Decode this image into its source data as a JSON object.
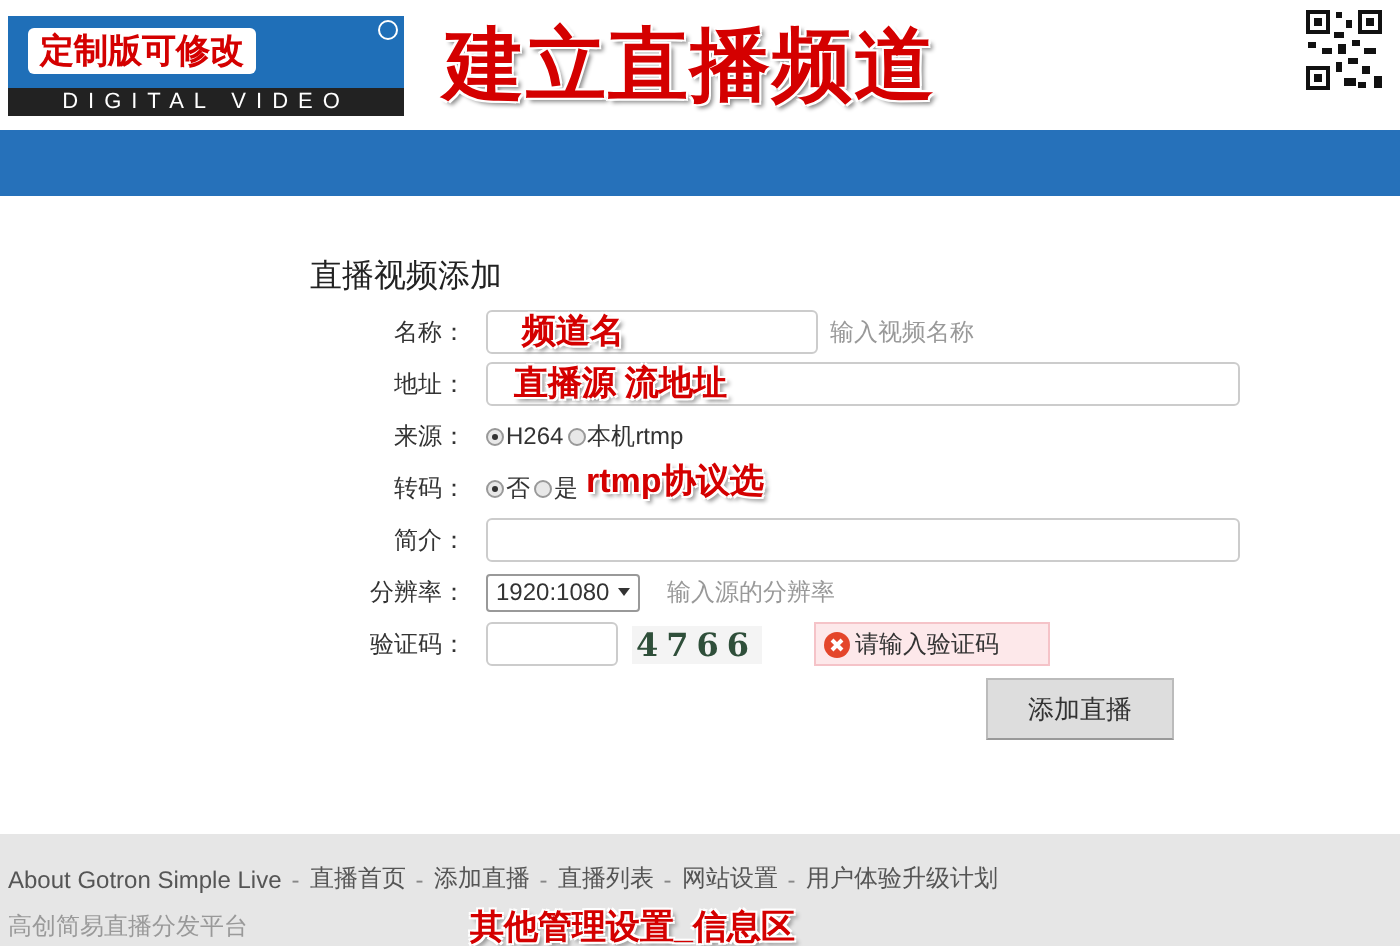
{
  "header": {
    "logo": {
      "overlay_text": "定制版可修改",
      "tagline": "DIGITAL VIDEO"
    },
    "title": "建立直播频道"
  },
  "form": {
    "title": "直播视频添加",
    "rows": [
      {
        "kind": "text",
        "label": "名称：",
        "value": "",
        "hint": "输入视频名称",
        "annotation": "频道名"
      },
      {
        "kind": "text",
        "label": "地址：",
        "value": "",
        "annotation": "直播源 流地址"
      },
      {
        "kind": "radio",
        "label": "来源：",
        "options": [
          {
            "label": "H264",
            "selected": true
          },
          {
            "label": "本机rtmp",
            "selected": false
          }
        ]
      },
      {
        "kind": "radio",
        "label": "转码：",
        "options": [
          {
            "label": "否",
            "selected": true
          },
          {
            "label": "是",
            "selected": false
          }
        ],
        "annotation": "rtmp协议选"
      },
      {
        "kind": "text",
        "label": "简介：",
        "value": ""
      },
      {
        "kind": "select",
        "label": "分辨率：",
        "value": "1920:1080",
        "hint": "输入源的分辨率"
      },
      {
        "kind": "captcha",
        "label": "验证码：",
        "value": "",
        "code": "4766",
        "error": "请输入验证码"
      }
    ],
    "submit": "添加直播"
  },
  "footer": {
    "separator": "-",
    "links": [
      "About Gotron Simple Live",
      "直播首页",
      "添加直播",
      "直播列表",
      "网站设置",
      "用户体验升级计划"
    ],
    "subtitle": "高创简易直播分发平台",
    "annotation": "其他管理设置_信息区"
  }
}
